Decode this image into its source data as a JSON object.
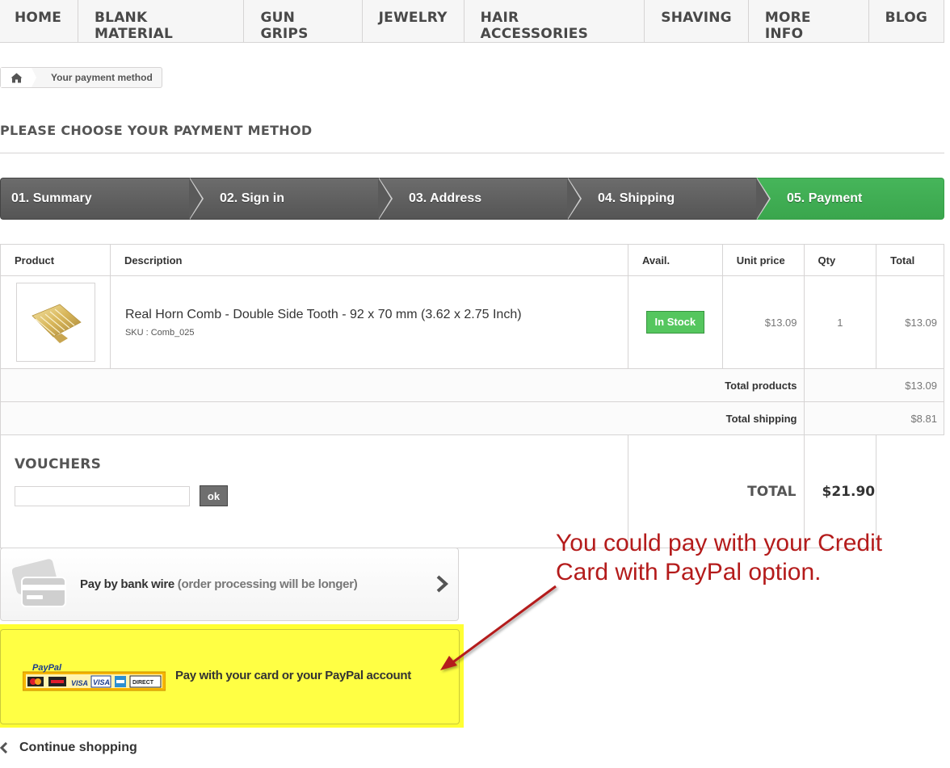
{
  "nav": {
    "items": [
      "HOME",
      "BLANK MATERIAL",
      "GUN GRIPS",
      "JEWELRY",
      "HAIR ACCESSORIES",
      "SHAVING",
      "MORE INFO",
      "BLOG"
    ]
  },
  "breadcrumb": {
    "home_icon": "home-icon",
    "current": "Your payment method"
  },
  "page": {
    "heading": "PLEASE CHOOSE YOUR PAYMENT METHOD"
  },
  "steps": [
    "01. Summary",
    "02. Sign in",
    "03. Address",
    "04. Shipping",
    "05. Payment"
  ],
  "colors": {
    "active_step": "#46b55a",
    "step": "#626262",
    "in_stock": "#55c65e",
    "highlight": "#ffff44",
    "annotation": "#b41b1b"
  },
  "cart": {
    "headers": {
      "product": "Product",
      "description": "Description",
      "avail": "Avail.",
      "unit_price": "Unit price",
      "qty": "Qty",
      "total": "Total"
    },
    "item": {
      "name": "Real Horn Comb - Double Side Tooth - 92 x 70 mm (3.62 x 2.75 Inch)",
      "sku": "SKU : Comb_025",
      "availability": "In Stock",
      "unit_price": "$13.09",
      "qty": "1",
      "total": "$13.09"
    },
    "total_products_label": "Total products",
    "total_products": "$13.09",
    "total_shipping_label": "Total shipping",
    "total_shipping": "$8.81",
    "total_label": "TOTAL",
    "total": "$21.90"
  },
  "vouchers": {
    "title": "VOUCHERS",
    "input_value": "",
    "button": "ok"
  },
  "payment": {
    "bank_wire_label": "Pay by bank wire",
    "bank_wire_note": "(order processing will be longer)",
    "paypal_label": "Pay with your card or your PayPal account",
    "paypal_logo_text": "PayPal"
  },
  "continue_shopping": "Continue shopping",
  "annotation": {
    "text": "You could pay with your Credit Card with PayPal option."
  }
}
